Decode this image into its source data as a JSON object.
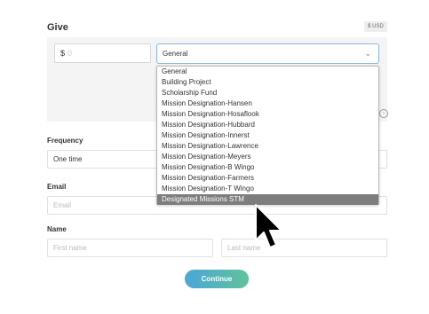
{
  "give": {
    "title": "Give",
    "currency_badge": "$ USD",
    "amount": {
      "prefix": "$",
      "placeholder": "0"
    },
    "fund_select": {
      "selected": "General",
      "options": [
        "General",
        "Building Project",
        "Scholarship Fund",
        "Mission Designation-Hansen",
        "Mission Designation-Hosaflook",
        "Mission Designation-Hubbard",
        "Mission Designation-Innerst",
        "Mission Designation-Lawrence",
        "Mission Designation-Meyers",
        "Mission Designation-B Wingo",
        "Mission Designation-Farmers",
        "Mission Designation-T Wingo",
        "Designated Missions STM"
      ],
      "highlighted_index": 12
    }
  },
  "frequency": {
    "label": "Frequency",
    "value": "One time"
  },
  "email": {
    "label": "Email",
    "placeholder": "Email"
  },
  "name": {
    "label": "Name",
    "first_placeholder": "First name",
    "last_placeholder": "Last name"
  },
  "continue_label": "Continue",
  "icons": {
    "chevron": "chevron-down-icon",
    "cursor": "mouse-pointer-icon"
  },
  "colors": {
    "accent_start": "#4ba6d8",
    "accent_end": "#5fc39a",
    "select_border": "#8fb6de"
  }
}
